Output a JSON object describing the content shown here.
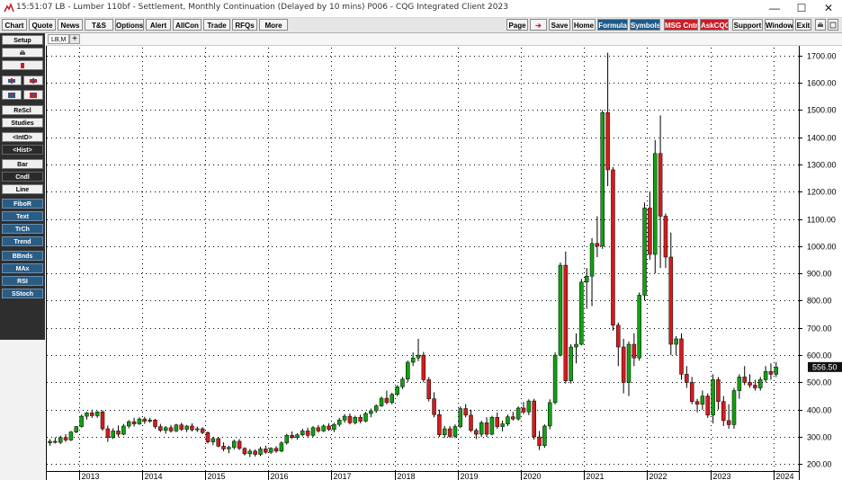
{
  "window": {
    "title": "15:51:07   LB - Lumber 110bf - Settlement, Monthly Continuation (Delayed by 10 mins)   P006 - CQG Integrated Client 2023",
    "minimize": "—",
    "maximize": "☐",
    "close": "✕"
  },
  "menu_left": [
    "Chart",
    "Quote",
    "News",
    "T&S",
    "Options",
    "Alert",
    "AllCon",
    "Trade",
    "RFQs",
    "More"
  ],
  "menu_right": {
    "page": "Page",
    "arrow": "➔",
    "save": "Save",
    "home": "Home",
    "formula": "Formula",
    "symbols": "Symbols",
    "msg": "MSG Cntr",
    "askcqg": "AskCQG",
    "support": "Support",
    "window": "Window",
    "exit": "Exit"
  },
  "sidebar": {
    "setup": "Setup",
    "resel": "ReScl",
    "studies": "Studies",
    "intd": "<IntD>",
    "hist": "<Hist>",
    "bar": "Bar",
    "cndl": "Cndl",
    "line": "Line",
    "studies_list": [
      "FiboR",
      "Text",
      "TrCh",
      "Trend",
      "BBnds",
      "MAx",
      "RSI",
      "SStoch"
    ]
  },
  "tab": {
    "label": "LB,M",
    "add": "+"
  },
  "colors": {
    "up": "#12a012",
    "down": "#d41c1c",
    "grid": "#000000",
    "price_label_bg": "#111111"
  },
  "chart_data": {
    "type": "candlestick",
    "symbol": "LB",
    "period": "Monthly",
    "last_price": "556.50",
    "y_ticks": [
      200,
      300,
      400,
      500,
      600,
      700,
      800,
      900,
      1000,
      1100,
      1200,
      1300,
      1400,
      1500,
      1600,
      1700
    ],
    "y_tick_labels": [
      "200.00",
      "300.00",
      "400.00",
      "500.00",
      "600.00",
      "700.00",
      "800.00",
      "900.00",
      "1000.00",
      "1100.00",
      "1200.00",
      "1300.00",
      "1400.00",
      "1500.00",
      "1600.00",
      "1700.00"
    ],
    "ylim": [
      175,
      1735
    ],
    "x_start": "2012-07",
    "x_labels": [
      "2013",
      "2014",
      "2015",
      "2016",
      "2017",
      "2018",
      "2019",
      "2020",
      "2021",
      "2022",
      "2023",
      "2024"
    ],
    "candles": [
      {
        "d": "2012-07",
        "o": 278,
        "h": 292,
        "l": 268,
        "c": 284
      },
      {
        "d": "2012-08",
        "o": 284,
        "h": 298,
        "l": 276,
        "c": 280
      },
      {
        "d": "2012-09",
        "o": 280,
        "h": 305,
        "l": 274,
        "c": 298
      },
      {
        "d": "2012-10",
        "o": 298,
        "h": 310,
        "l": 282,
        "c": 289
      },
      {
        "d": "2012-11",
        "o": 289,
        "h": 322,
        "l": 285,
        "c": 318
      },
      {
        "d": "2012-12",
        "o": 318,
        "h": 340,
        "l": 314,
        "c": 338
      },
      {
        "d": "2013-01",
        "o": 338,
        "h": 382,
        "l": 334,
        "c": 376
      },
      {
        "d": "2013-02",
        "o": 376,
        "h": 392,
        "l": 364,
        "c": 388
      },
      {
        "d": "2013-03",
        "o": 388,
        "h": 400,
        "l": 370,
        "c": 378
      },
      {
        "d": "2013-04",
        "o": 378,
        "h": 395,
        "l": 370,
        "c": 392
      },
      {
        "d": "2013-05",
        "o": 392,
        "h": 398,
        "l": 322,
        "c": 330
      },
      {
        "d": "2013-06",
        "o": 330,
        "h": 342,
        "l": 282,
        "c": 298
      },
      {
        "d": "2013-07",
        "o": 298,
        "h": 332,
        "l": 292,
        "c": 322
      },
      {
        "d": "2013-08",
        "o": 322,
        "h": 342,
        "l": 300,
        "c": 310
      },
      {
        "d": "2013-09",
        "o": 310,
        "h": 348,
        "l": 306,
        "c": 340
      },
      {
        "d": "2013-10",
        "o": 340,
        "h": 362,
        "l": 332,
        "c": 356
      },
      {
        "d": "2013-11",
        "o": 356,
        "h": 370,
        "l": 338,
        "c": 348
      },
      {
        "d": "2013-12",
        "o": 348,
        "h": 372,
        "l": 344,
        "c": 366
      },
      {
        "d": "2014-01",
        "o": 366,
        "h": 374,
        "l": 348,
        "c": 358
      },
      {
        "d": "2014-02",
        "o": 358,
        "h": 370,
        "l": 352,
        "c": 362
      },
      {
        "d": "2014-03",
        "o": 362,
        "h": 366,
        "l": 330,
        "c": 338
      },
      {
        "d": "2014-04",
        "o": 338,
        "h": 348,
        "l": 318,
        "c": 324
      },
      {
        "d": "2014-05",
        "o": 324,
        "h": 340,
        "l": 312,
        "c": 334
      },
      {
        "d": "2014-06",
        "o": 334,
        "h": 344,
        "l": 316,
        "c": 322
      },
      {
        "d": "2014-07",
        "o": 322,
        "h": 348,
        "l": 318,
        "c": 344
      },
      {
        "d": "2014-08",
        "o": 344,
        "h": 352,
        "l": 322,
        "c": 328
      },
      {
        "d": "2014-09",
        "o": 328,
        "h": 344,
        "l": 318,
        "c": 340
      },
      {
        "d": "2014-10",
        "o": 340,
        "h": 350,
        "l": 320,
        "c": 326
      },
      {
        "d": "2014-11",
        "o": 326,
        "h": 338,
        "l": 318,
        "c": 330
      },
      {
        "d": "2014-12",
        "o": 330,
        "h": 336,
        "l": 310,
        "c": 316
      },
      {
        "d": "2015-01",
        "o": 316,
        "h": 320,
        "l": 276,
        "c": 282
      },
      {
        "d": "2015-02",
        "o": 282,
        "h": 300,
        "l": 270,
        "c": 294
      },
      {
        "d": "2015-03",
        "o": 294,
        "h": 300,
        "l": 262,
        "c": 266
      },
      {
        "d": "2015-04",
        "o": 266,
        "h": 280,
        "l": 248,
        "c": 256
      },
      {
        "d": "2015-05",
        "o": 256,
        "h": 268,
        "l": 240,
        "c": 262
      },
      {
        "d": "2015-06",
        "o": 262,
        "h": 290,
        "l": 254,
        "c": 284
      },
      {
        "d": "2015-07",
        "o": 284,
        "h": 292,
        "l": 252,
        "c": 258
      },
      {
        "d": "2015-08",
        "o": 258,
        "h": 262,
        "l": 232,
        "c": 238
      },
      {
        "d": "2015-09",
        "o": 238,
        "h": 256,
        "l": 226,
        "c": 248
      },
      {
        "d": "2015-10",
        "o": 248,
        "h": 254,
        "l": 228,
        "c": 236
      },
      {
        "d": "2015-11",
        "o": 236,
        "h": 264,
        "l": 230,
        "c": 256
      },
      {
        "d": "2015-12",
        "o": 256,
        "h": 268,
        "l": 238,
        "c": 244
      },
      {
        "d": "2016-01",
        "o": 244,
        "h": 262,
        "l": 238,
        "c": 258
      },
      {
        "d": "2016-02",
        "o": 258,
        "h": 266,
        "l": 242,
        "c": 248
      },
      {
        "d": "2016-03",
        "o": 248,
        "h": 284,
        "l": 244,
        "c": 278
      },
      {
        "d": "2016-04",
        "o": 278,
        "h": 312,
        "l": 272,
        "c": 306
      },
      {
        "d": "2016-05",
        "o": 306,
        "h": 320,
        "l": 292,
        "c": 298
      },
      {
        "d": "2016-06",
        "o": 298,
        "h": 314,
        "l": 290,
        "c": 308
      },
      {
        "d": "2016-07",
        "o": 308,
        "h": 330,
        "l": 302,
        "c": 322
      },
      {
        "d": "2016-08",
        "o": 322,
        "h": 334,
        "l": 298,
        "c": 306
      },
      {
        "d": "2016-09",
        "o": 306,
        "h": 340,
        "l": 300,
        "c": 334
      },
      {
        "d": "2016-10",
        "o": 334,
        "h": 344,
        "l": 316,
        "c": 322
      },
      {
        "d": "2016-11",
        "o": 322,
        "h": 346,
        "l": 318,
        "c": 340
      },
      {
        "d": "2016-12",
        "o": 340,
        "h": 350,
        "l": 322,
        "c": 328
      },
      {
        "d": "2017-01",
        "o": 328,
        "h": 352,
        "l": 318,
        "c": 346
      },
      {
        "d": "2017-02",
        "o": 346,
        "h": 370,
        "l": 338,
        "c": 362
      },
      {
        "d": "2017-03",
        "o": 362,
        "h": 384,
        "l": 352,
        "c": 376
      },
      {
        "d": "2017-04",
        "o": 376,
        "h": 386,
        "l": 346,
        "c": 352
      },
      {
        "d": "2017-05",
        "o": 352,
        "h": 378,
        "l": 346,
        "c": 372
      },
      {
        "d": "2017-06",
        "o": 372,
        "h": 382,
        "l": 350,
        "c": 358
      },
      {
        "d": "2017-07",
        "o": 358,
        "h": 392,
        "l": 354,
        "c": 386
      },
      {
        "d": "2017-08",
        "o": 386,
        "h": 404,
        "l": 372,
        "c": 396
      },
      {
        "d": "2017-09",
        "o": 396,
        "h": 420,
        "l": 388,
        "c": 414
      },
      {
        "d": "2017-10",
        "o": 414,
        "h": 448,
        "l": 410,
        "c": 442
      },
      {
        "d": "2017-11",
        "o": 442,
        "h": 470,
        "l": 420,
        "c": 426
      },
      {
        "d": "2017-12",
        "o": 426,
        "h": 462,
        "l": 420,
        "c": 456
      },
      {
        "d": "2018-01",
        "o": 456,
        "h": 490,
        "l": 450,
        "c": 484
      },
      {
        "d": "2018-02",
        "o": 484,
        "h": 520,
        "l": 476,
        "c": 512
      },
      {
        "d": "2018-03",
        "o": 512,
        "h": 580,
        "l": 502,
        "c": 574
      },
      {
        "d": "2018-04",
        "o": 574,
        "h": 610,
        "l": 560,
        "c": 590
      },
      {
        "d": "2018-05",
        "o": 590,
        "h": 660,
        "l": 578,
        "c": 600
      },
      {
        "d": "2018-06",
        "o": 600,
        "h": 612,
        "l": 500,
        "c": 510
      },
      {
        "d": "2018-07",
        "o": 510,
        "h": 520,
        "l": 430,
        "c": 440
      },
      {
        "d": "2018-08",
        "o": 440,
        "h": 464,
        "l": 372,
        "c": 382
      },
      {
        "d": "2018-09",
        "o": 382,
        "h": 400,
        "l": 300,
        "c": 308
      },
      {
        "d": "2018-10",
        "o": 308,
        "h": 340,
        "l": 296,
        "c": 330
      },
      {
        "d": "2018-11",
        "o": 330,
        "h": 340,
        "l": 296,
        "c": 302
      },
      {
        "d": "2018-12",
        "o": 302,
        "h": 346,
        "l": 296,
        "c": 338
      },
      {
        "d": "2019-01",
        "o": 338,
        "h": 412,
        "l": 332,
        "c": 404
      },
      {
        "d": "2019-02",
        "o": 404,
        "h": 420,
        "l": 372,
        "c": 380
      },
      {
        "d": "2019-03",
        "o": 380,
        "h": 400,
        "l": 318,
        "c": 324
      },
      {
        "d": "2019-04",
        "o": 324,
        "h": 332,
        "l": 292,
        "c": 310
      },
      {
        "d": "2019-05",
        "o": 310,
        "h": 360,
        "l": 300,
        "c": 352
      },
      {
        "d": "2019-06",
        "o": 352,
        "h": 372,
        "l": 300,
        "c": 310
      },
      {
        "d": "2019-07",
        "o": 310,
        "h": 378,
        "l": 306,
        "c": 372
      },
      {
        "d": "2019-08",
        "o": 372,
        "h": 390,
        "l": 330,
        "c": 338
      },
      {
        "d": "2019-09",
        "o": 338,
        "h": 360,
        "l": 320,
        "c": 348
      },
      {
        "d": "2019-10",
        "o": 348,
        "h": 382,
        "l": 340,
        "c": 374
      },
      {
        "d": "2019-11",
        "o": 374,
        "h": 392,
        "l": 360,
        "c": 366
      },
      {
        "d": "2019-12",
        "o": 366,
        "h": 412,
        "l": 360,
        "c": 406
      },
      {
        "d": "2020-01",
        "o": 406,
        "h": 428,
        "l": 384,
        "c": 392
      },
      {
        "d": "2020-02",
        "o": 392,
        "h": 438,
        "l": 380,
        "c": 432
      },
      {
        "d": "2020-03",
        "o": 432,
        "h": 440,
        "l": 290,
        "c": 300
      },
      {
        "d": "2020-04",
        "o": 300,
        "h": 322,
        "l": 252,
        "c": 268
      },
      {
        "d": "2020-05",
        "o": 268,
        "h": 346,
        "l": 260,
        "c": 340
      },
      {
        "d": "2020-06",
        "o": 340,
        "h": 438,
        "l": 328,
        "c": 426
      },
      {
        "d": "2020-07",
        "o": 426,
        "h": 610,
        "l": 420,
        "c": 600
      },
      {
        "d": "2020-08",
        "o": 600,
        "h": 940,
        "l": 596,
        "c": 930
      },
      {
        "d": "2020-09",
        "o": 930,
        "h": 980,
        "l": 496,
        "c": 506
      },
      {
        "d": "2020-10",
        "o": 506,
        "h": 640,
        "l": 496,
        "c": 630
      },
      {
        "d": "2020-11",
        "o": 630,
        "h": 680,
        "l": 570,
        "c": 640
      },
      {
        "d": "2020-12",
        "o": 640,
        "h": 880,
        "l": 636,
        "c": 868
      },
      {
        "d": "2021-01",
        "o": 868,
        "h": 920,
        "l": 770,
        "c": 890
      },
      {
        "d": "2021-02",
        "o": 890,
        "h": 1030,
        "l": 780,
        "c": 1010
      },
      {
        "d": "2021-03",
        "o": 1010,
        "h": 1110,
        "l": 960,
        "c": 1000
      },
      {
        "d": "2021-04",
        "o": 1000,
        "h": 1500,
        "l": 990,
        "c": 1490
      },
      {
        "d": "2021-05",
        "o": 1490,
        "h": 1710,
        "l": 1220,
        "c": 1280
      },
      {
        "d": "2021-06",
        "o": 1280,
        "h": 1290,
        "l": 690,
        "c": 710
      },
      {
        "d": "2021-07",
        "o": 710,
        "h": 720,
        "l": 560,
        "c": 630
      },
      {
        "d": "2021-08",
        "o": 630,
        "h": 660,
        "l": 460,
        "c": 500
      },
      {
        "d": "2021-09",
        "o": 500,
        "h": 650,
        "l": 450,
        "c": 640
      },
      {
        "d": "2021-10",
        "o": 640,
        "h": 680,
        "l": 560,
        "c": 590
      },
      {
        "d": "2021-11",
        "o": 590,
        "h": 830,
        "l": 580,
        "c": 820
      },
      {
        "d": "2021-12",
        "o": 820,
        "h": 1160,
        "l": 800,
        "c": 1140
      },
      {
        "d": "2022-01",
        "o": 1140,
        "h": 1200,
        "l": 950,
        "c": 970
      },
      {
        "d": "2022-02",
        "o": 970,
        "h": 1390,
        "l": 900,
        "c": 1340
      },
      {
        "d": "2022-03",
        "o": 1340,
        "h": 1480,
        "l": 920,
        "c": 1110
      },
      {
        "d": "2022-04",
        "o": 1110,
        "h": 1120,
        "l": 920,
        "c": 960
      },
      {
        "d": "2022-05",
        "o": 960,
        "h": 1050,
        "l": 600,
        "c": 640
      },
      {
        "d": "2022-06",
        "o": 640,
        "h": 670,
        "l": 600,
        "c": 660
      },
      {
        "d": "2022-07",
        "o": 660,
        "h": 680,
        "l": 510,
        "c": 530
      },
      {
        "d": "2022-08",
        "o": 530,
        "h": 560,
        "l": 480,
        "c": 500
      },
      {
        "d": "2022-09",
        "o": 500,
        "h": 520,
        "l": 420,
        "c": 430
      },
      {
        "d": "2022-10",
        "o": 430,
        "h": 440,
        "l": 390,
        "c": 420
      },
      {
        "d": "2022-11",
        "o": 420,
        "h": 470,
        "l": 400,
        "c": 450
      },
      {
        "d": "2022-12",
        "o": 450,
        "h": 460,
        "l": 370,
        "c": 380
      },
      {
        "d": "2023-01",
        "o": 380,
        "h": 530,
        "l": 350,
        "c": 510
      },
      {
        "d": "2023-02",
        "o": 510,
        "h": 520,
        "l": 400,
        "c": 430
      },
      {
        "d": "2023-03",
        "o": 430,
        "h": 450,
        "l": 340,
        "c": 360
      },
      {
        "d": "2023-04",
        "o": 360,
        "h": 420,
        "l": 330,
        "c": 345
      },
      {
        "d": "2023-05",
        "o": 345,
        "h": 480,
        "l": 330,
        "c": 470
      },
      {
        "d": "2023-06",
        "o": 470,
        "h": 530,
        "l": 440,
        "c": 520
      },
      {
        "d": "2023-07",
        "o": 520,
        "h": 560,
        "l": 490,
        "c": 500
      },
      {
        "d": "2023-08",
        "o": 500,
        "h": 530,
        "l": 480,
        "c": 490
      },
      {
        "d": "2023-09",
        "o": 490,
        "h": 510,
        "l": 470,
        "c": 480
      },
      {
        "d": "2023-10",
        "o": 480,
        "h": 520,
        "l": 470,
        "c": 510
      },
      {
        "d": "2023-11",
        "o": 510,
        "h": 560,
        "l": 500,
        "c": 540
      },
      {
        "d": "2023-12",
        "o": 540,
        "h": 570,
        "l": 510,
        "c": 530
      },
      {
        "d": "2024-01",
        "o": 530,
        "h": 575,
        "l": 520,
        "c": 556
      }
    ]
  }
}
